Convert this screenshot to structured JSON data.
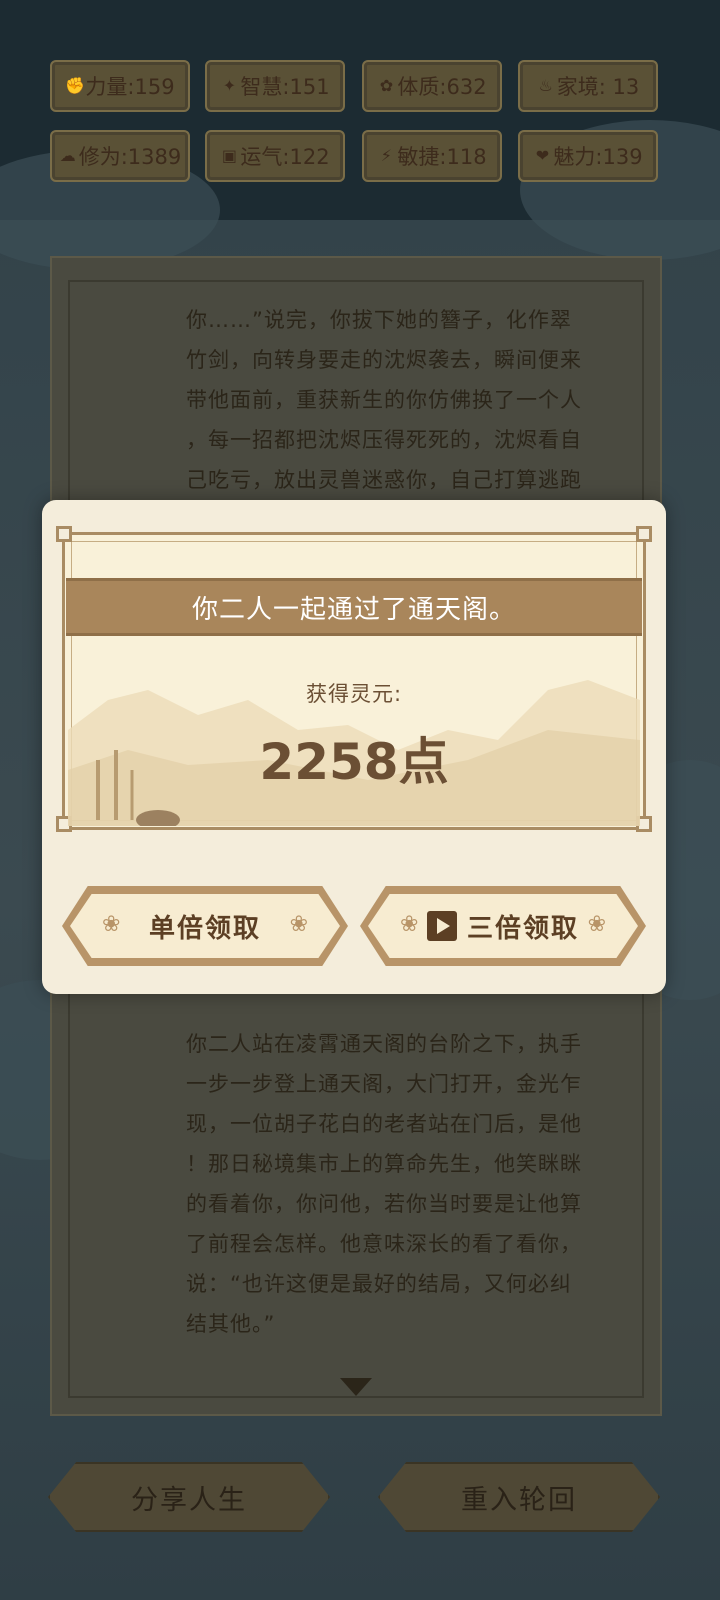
{
  "stats": [
    {
      "icon": "strength-icon",
      "glyph": "✊",
      "label": "力量:159"
    },
    {
      "icon": "wisdom-icon",
      "glyph": "✦",
      "label": "智慧:151"
    },
    {
      "icon": "constitution-icon",
      "glyph": "✿",
      "label": "体质:632"
    },
    {
      "icon": "family-icon",
      "glyph": "♨",
      "label": "家境: 13"
    },
    {
      "icon": "cultivation-icon",
      "glyph": "☁",
      "label": "修为:1389"
    },
    {
      "icon": "luck-icon",
      "glyph": "▣",
      "label": "运气:122"
    },
    {
      "icon": "agility-icon",
      "glyph": "⚡",
      "label": "敏捷:118"
    },
    {
      "icon": "charm-icon",
      "glyph": "❤",
      "label": "魅力:139"
    }
  ],
  "story_top": [
    "你……”说完，你拔下她的簪子，化作翠",
    "竹剑，向转身要走的沈烬袭去，瞬间便来",
    "带他面前，重获新生的你仿佛换了一个人",
    "，每一招都把沈烬压得死死的，沈烬看自",
    "己吃亏，放出灵兽迷惑你，自己打算逃跑"
  ],
  "story_bottom": [
    "你二人站在凌霄通天阁的台阶之下，执手",
    "一步一步登上通天阁，大门打开，金光乍",
    "现，一位胡子花白的老者站在门后，是他",
    "！那日秘境集市上的算命先生，他笑眯眯",
    "的看着你，你问他，若你当时要是让他算",
    "了前程会怎样。他意味深长的看了看你，",
    "说：“也许这便是最好的结局，又何必纠",
    "结其他。”"
  ],
  "modal": {
    "title": "你二人一起通过了通天阁。",
    "reward_label": "获得灵元:",
    "reward_amount": "2258点",
    "single_button": "单倍领取",
    "triple_button": "三倍领取"
  },
  "bottom": {
    "share_button": "分享人生",
    "restart_button": "重入轮回"
  }
}
